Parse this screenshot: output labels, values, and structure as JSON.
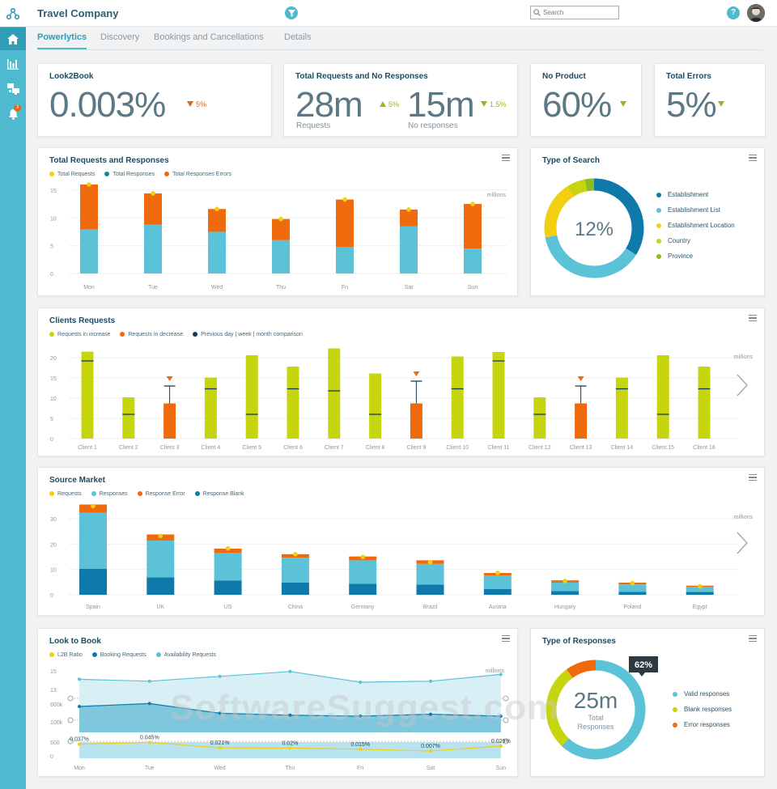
{
  "app": {
    "title": "Travel Company"
  },
  "search": {
    "placeholder": "Search"
  },
  "sidebar": {
    "notification_count": "3"
  },
  "tabs": [
    "Powerlytics",
    "Discovery",
    "Bookings and Cancellations",
    "Details"
  ],
  "kpis": {
    "look2book": {
      "title": "Look2Book",
      "value": "0.003%",
      "delta": "5%"
    },
    "requests": {
      "title": "Total Requests and No Responses",
      "value1": "28m",
      "delta1": "5%",
      "label1": "Requests",
      "value2": "15m",
      "delta2": "1.5%",
      "label2": "No responses"
    },
    "no_product": {
      "title": "No Product",
      "value": "60%"
    },
    "errors": {
      "title": "Total Errors",
      "value": "5%"
    }
  },
  "colors": {
    "teal": "#5bc2d8",
    "orange": "#ef6a0d",
    "yellow": "#f2cf11",
    "lime": "#c7d50f",
    "darkblue": "#0f7aaa",
    "navy": "#173d56",
    "green": "#8bbd21"
  },
  "charts": {
    "trr": {
      "title": "Total Requests and Responses",
      "unit": "millions",
      "legend": [
        "Total Requests",
        "Total Responses",
        "Total Responses Errors"
      ]
    },
    "search": {
      "title": "Type of Search",
      "center": "12%",
      "legend": [
        "Establishment",
        "Establishment List",
        "Establishment Location",
        "Country",
        "Province"
      ]
    },
    "clients": {
      "title": "Clients Requests",
      "unit": "millions",
      "legend": [
        "Requests in increase",
        "Requests in decrease",
        "Previous day | week | month comparison"
      ]
    },
    "source": {
      "title": "Source Market",
      "unit": "millions",
      "legend": [
        "Requests",
        "Responses",
        "Response Error",
        "Response Blank"
      ]
    },
    "l2b": {
      "title": "Look to Book",
      "unit": "millions",
      "legend": [
        "L2B Ratio",
        "Booking Requests",
        "Availability Requests"
      ]
    },
    "responses": {
      "title": "Type of Responses",
      "center_value": "25m",
      "center_label1": "Total",
      "center_label2": "Responses",
      "callout": "62%",
      "legend": [
        "Valid responses",
        "Blank responses",
        "Error responses"
      ]
    }
  },
  "watermark": "SoftwareSuggest.com",
  "chart_data": [
    {
      "type": "bar",
      "title": "Total Requests and Responses",
      "categories": [
        "Mon",
        "Tue",
        "Wed",
        "Thu",
        "Fri",
        "Sat",
        "Sun"
      ],
      "ylim": [
        0,
        15
      ],
      "yticks": [
        0,
        5,
        10,
        15
      ],
      "series": [
        {
          "name": "Total Requests",
          "values": [
            16,
            14.4,
            11.6,
            9.8,
            13.3,
            11.5,
            12.5
          ]
        },
        {
          "name": "Total Responses",
          "values": [
            7.9,
            8.8,
            7.5,
            6,
            4.8,
            8.5,
            4.5
          ]
        },
        {
          "name": "Total Responses Errors",
          "values": [
            8.1,
            5.6,
            4.1,
            3.8,
            8.5,
            3,
            8
          ]
        }
      ]
    },
    {
      "type": "pie",
      "title": "Type of Search",
      "categories": [
        "Establishment",
        "Establishment List",
        "Establishment Location",
        "Country",
        "Province"
      ],
      "values": [
        34,
        38,
        19,
        6,
        3
      ]
    },
    {
      "type": "bar",
      "title": "Clients Requests",
      "categories": [
        "Client 1",
        "Client 2",
        "Client 3",
        "Client 4",
        "Client 5",
        "Client 6",
        "Client 7",
        "Client 8",
        "Client 9",
        "Client 10",
        "Client 11",
        "Client 12",
        "Client 13",
        "Client 14",
        "Client 15",
        "Client 16"
      ],
      "ylim": [
        0,
        20
      ],
      "yticks": [
        0,
        5,
        10,
        15,
        20
      ],
      "series": [
        {
          "name": "Requests",
          "values": [
            21.5,
            10.2,
            8.7,
            15.1,
            20.6,
            17.8,
            22.3,
            16.1,
            8.7,
            20.3,
            21.4,
            10.2,
            8.7,
            15.1,
            20.6,
            17.8
          ]
        },
        {
          "name": "Previous day | week | month comparison",
          "values": [
            19.2,
            6,
            13,
            12.3,
            6,
            12.3,
            11.8,
            6,
            14.2,
            12.3,
            19.2,
            6,
            13,
            12.3,
            6,
            12.3
          ]
        }
      ],
      "decrease": [
        false,
        false,
        true,
        false,
        false,
        false,
        false,
        false,
        true,
        false,
        false,
        false,
        true,
        false,
        false,
        false
      ]
    },
    {
      "type": "bar",
      "title": "Source Market",
      "categories": [
        "Spain",
        "UK",
        "US",
        "China",
        "Germany",
        "Brazil",
        "Austria",
        "Hungary",
        "Poland",
        "Egypt"
      ],
      "ylim": [
        0,
        30
      ],
      "yticks": [
        0,
        10,
        20,
        30
      ],
      "series": [
        {
          "name": "Requests",
          "values": [
            35,
            23.2,
            18.3,
            16,
            14.9,
            12.9,
            8.6,
            5.4,
            4.6,
            3.3
          ]
        },
        {
          "name": "Responses",
          "values": [
            22,
            14.5,
            10.9,
            9.8,
            9.3,
            8.2,
            5.3,
            3.3,
            2.9,
            2
          ]
        },
        {
          "name": "Response Error",
          "values": [
            3.3,
            2.4,
            1.7,
            1.4,
            1.5,
            1.4,
            1,
            0.9,
            0.7,
            0.5
          ]
        },
        {
          "name": "Response Blank",
          "values": [
            10.3,
            6.9,
            5.6,
            4.8,
            4.3,
            4,
            2.3,
            1.5,
            1.2,
            1.1
          ]
        }
      ]
    },
    {
      "type": "line",
      "title": "Look to Book",
      "categories": [
        "Mon",
        "Tue",
        "Wed",
        "Thu",
        "Fri",
        "Sat",
        "Sun"
      ],
      "yticks_left": [
        "0",
        "600",
        "100k",
        "600k",
        "13",
        "15"
      ],
      "series": [
        {
          "name": "L2B Ratio",
          "values": [
            0.037,
            0.045,
            0.021,
            0.02,
            0.015,
            0.007,
            0.029
          ],
          "labels": [
            "0.037%",
            "0.045%",
            "0.021%",
            "0.02%",
            "0.015%",
            "0.007%",
            "0.029%"
          ]
        },
        {
          "name": "Booking Requests",
          "values": [
            55,
            58,
            48,
            46,
            45,
            47,
            45
          ]
        },
        {
          "name": "Availability Requests",
          "values": [
            83,
            81,
            86,
            91,
            80,
            81,
            88
          ]
        }
      ]
    },
    {
      "type": "pie",
      "title": "Type of Responses",
      "categories": [
        "Valid responses",
        "Blank responses",
        "Error responses"
      ],
      "values": [
        62,
        28,
        10
      ]
    }
  ]
}
